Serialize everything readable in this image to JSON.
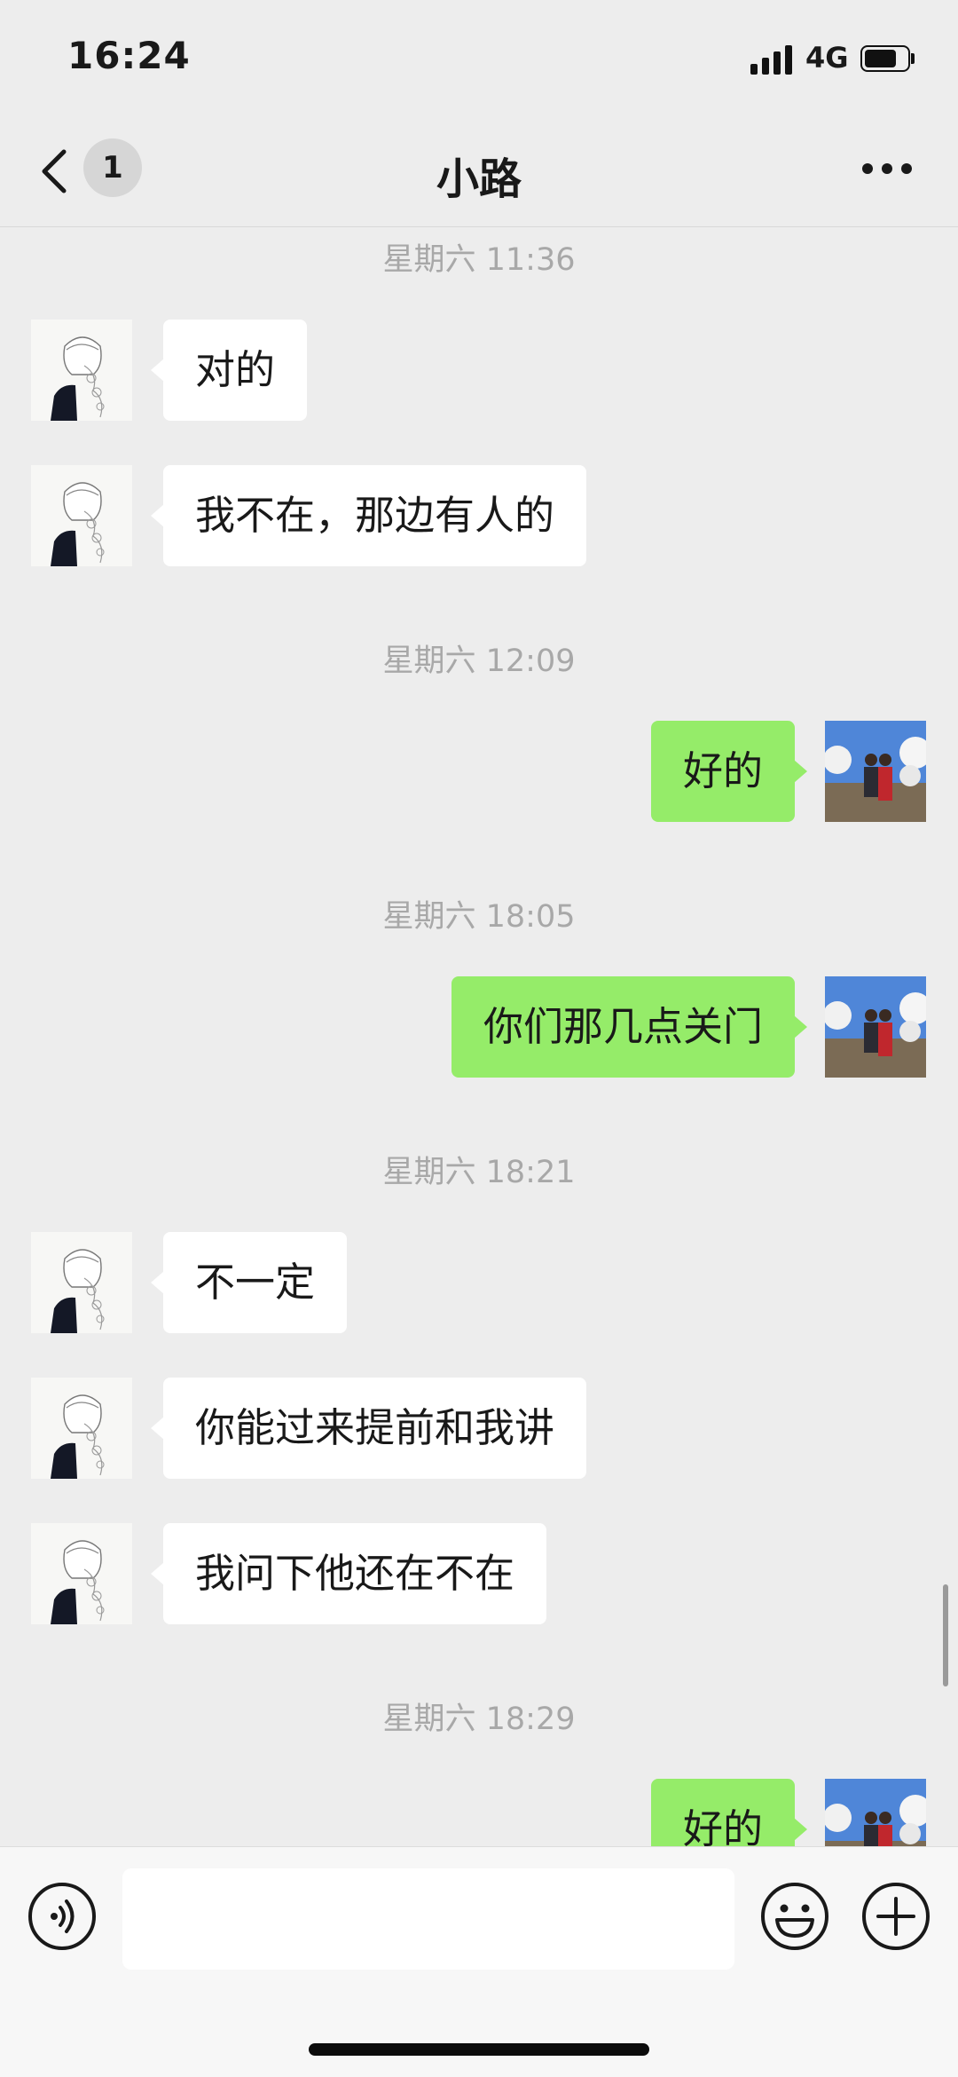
{
  "status_bar": {
    "time": "16:24",
    "network": "4G",
    "signal_icon": "cellular-signal-icon",
    "battery_icon": "battery-icon",
    "battery_level": 0.7
  },
  "header": {
    "back_icon": "chevron-left-icon",
    "unread_badge": "1",
    "title": "小路",
    "more_icon": "ellipsis-icon"
  },
  "colors": {
    "background": "#ededed",
    "incoming_bubble": "#ffffff",
    "outgoing_bubble": "#95ec69",
    "timestamp": "#a8a8a8"
  },
  "messages": [
    {
      "type": "timestamp",
      "text": "星期六 11:36"
    },
    {
      "type": "incoming",
      "text": "对的"
    },
    {
      "type": "incoming",
      "text": "我不在，那边有人的"
    },
    {
      "type": "timestamp",
      "text": "星期六 12:09"
    },
    {
      "type": "outgoing",
      "text": "好的"
    },
    {
      "type": "timestamp",
      "text": "星期六 18:05"
    },
    {
      "type": "outgoing",
      "text": "你们那几点关门"
    },
    {
      "type": "timestamp",
      "text": "星期六 18:21"
    },
    {
      "type": "incoming",
      "text": "不一定"
    },
    {
      "type": "incoming",
      "text": "你能过来提前和我讲"
    },
    {
      "type": "incoming",
      "text": "我问下他还在不在"
    },
    {
      "type": "timestamp",
      "text": "星期六 18:29"
    },
    {
      "type": "outgoing",
      "text": "好的"
    }
  ],
  "input_bar": {
    "text_value": "",
    "voice_icon": "voice-icon",
    "emoji_icon": "emoji-icon",
    "plus_icon": "plus-icon"
  }
}
